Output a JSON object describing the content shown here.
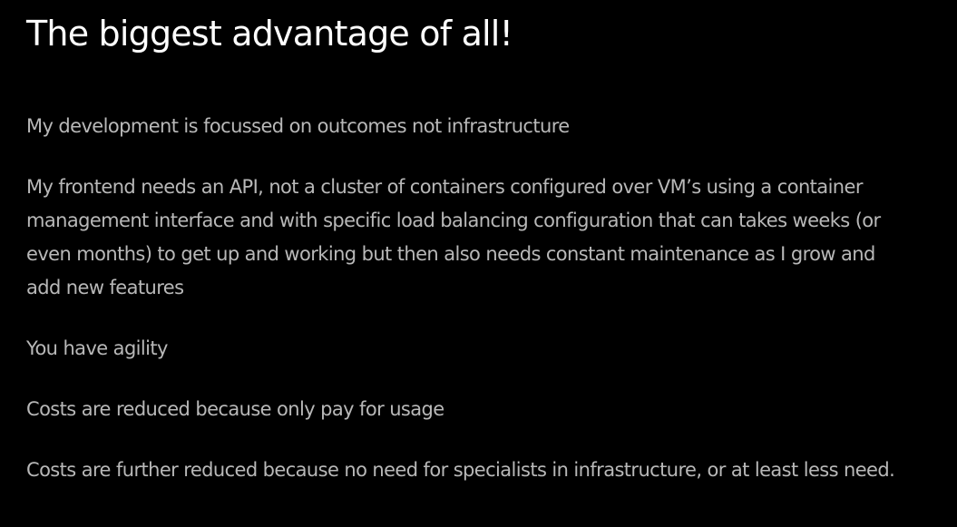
{
  "slide": {
    "title": "The biggest advantage of all!",
    "points": [
      "My development is focussed on outcomes not infrastructure",
      "My frontend needs an API, not a cluster of containers configured over VM’s using a container management interface and with specific load balancing configuration that can takes weeks (or even months) to get up and working but then also needs constant maintenance as I grow and add new features",
      "You have agility",
      "Costs are reduced because only pay for usage",
      "Costs are further reduced because no need for specialists in infrastructure, or at least less need."
    ]
  },
  "colors": {
    "background": "#000000",
    "title": "#ffffff",
    "body_text": "#b8b8b8"
  }
}
